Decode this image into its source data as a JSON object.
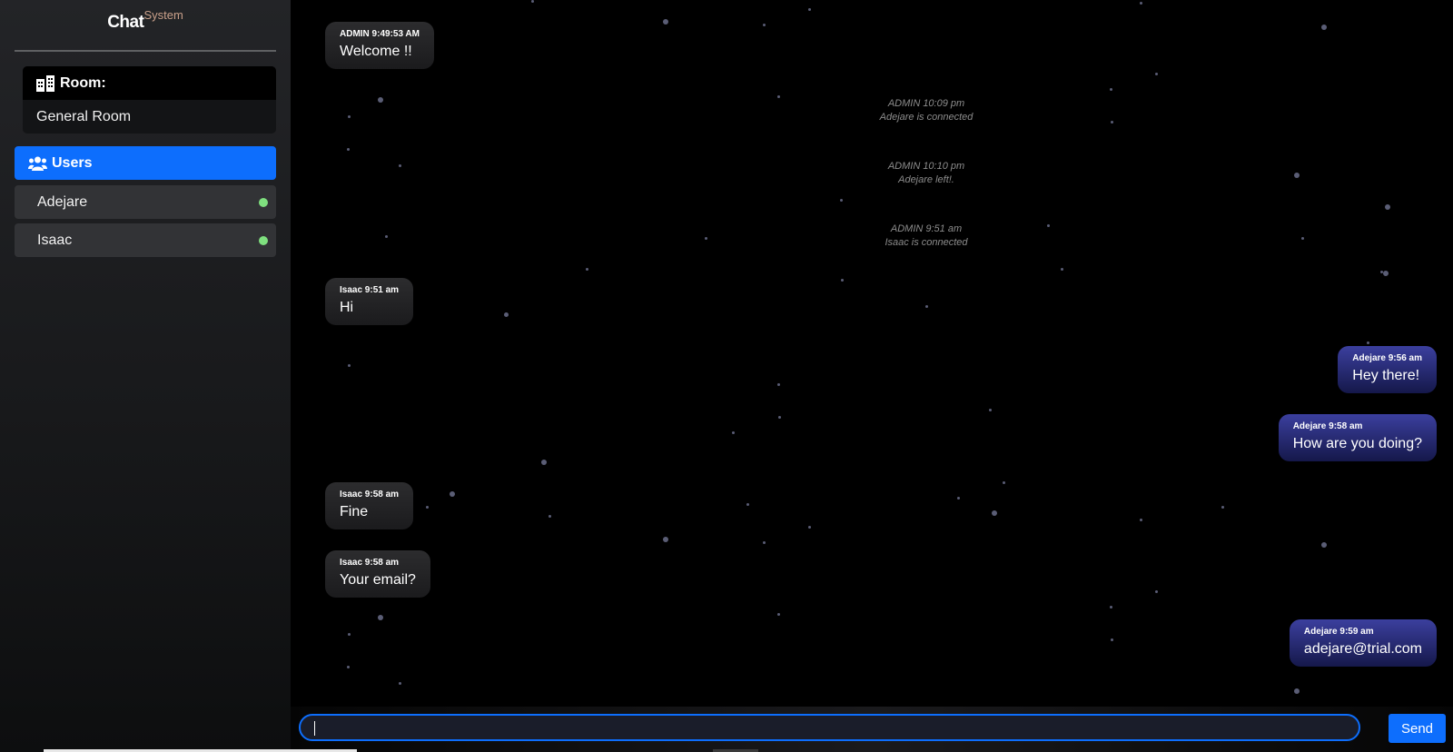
{
  "app": {
    "logo_main": "Chat",
    "logo_sup": "System"
  },
  "room": {
    "label": "Room:",
    "name": "General Room"
  },
  "users": {
    "label": "Users",
    "list": [
      {
        "name": "Adejare",
        "status": "online"
      },
      {
        "name": "Isaac",
        "status": "online"
      }
    ]
  },
  "messages": [
    {
      "type": "bubble",
      "side": "left",
      "meta": "ADMIN 9:49:53 AM",
      "text": "Welcome !!"
    },
    {
      "type": "system",
      "meta": "ADMIN 10:09 pm",
      "text": "Adejare is connected"
    },
    {
      "type": "system",
      "meta": "ADMIN 10:10 pm",
      "text": "Adejare left!."
    },
    {
      "type": "system",
      "meta": "ADMIN 9:51 am",
      "text": "Isaac is connected"
    },
    {
      "type": "bubble",
      "side": "left",
      "meta": "Isaac 9:51 am",
      "text": "Hi"
    },
    {
      "type": "bubble",
      "side": "right",
      "meta": "Adejare 9:56 am",
      "text": "Hey there!"
    },
    {
      "type": "bubble",
      "side": "right",
      "meta": "Adejare 9:58 am",
      "text": "How are you doing?"
    },
    {
      "type": "bubble",
      "side": "left",
      "meta": "Isaac 9:58 am",
      "text": "Fine"
    },
    {
      "type": "bubble",
      "side": "left",
      "meta": "Isaac 9:58 am",
      "text": "Your email?"
    },
    {
      "type": "bubble",
      "side": "right",
      "meta": "Adejare 9:59 am",
      "text": "adejare@trial.com"
    }
  ],
  "composer": {
    "value": "",
    "placeholder": "",
    "send_label": "Send"
  },
  "colors": {
    "accent": "#0d6efd",
    "online": "#7fe07f",
    "self_bubble": "#3b3f9e",
    "other_bubble": "#2c2c2e"
  }
}
